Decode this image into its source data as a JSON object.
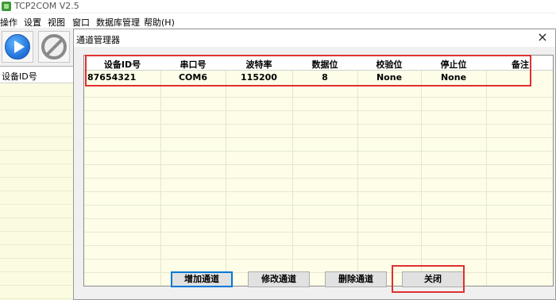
{
  "app": {
    "title": "TCP2COM V2.5"
  },
  "menu": {
    "items": [
      "操作",
      "设置",
      "视图",
      "窗口",
      "数据库管理",
      "帮助(H)"
    ]
  },
  "toolbar": {
    "start_icon": "play-icon",
    "stop_icon": "stop-icon"
  },
  "left_panel": {
    "header": "设备ID号"
  },
  "dialog": {
    "title": "通道管理器",
    "close_glyph": "×",
    "columns": [
      "设备ID号",
      "串口号",
      "波特率",
      "数据位",
      "校验位",
      "停止位",
      "备注"
    ],
    "rows": [
      [
        "87654321",
        "COM6",
        "115200",
        "8",
        "None",
        "None",
        ""
      ]
    ],
    "buttons": {
      "add": "增加通道",
      "edit": "修改通道",
      "delete": "删除通道",
      "close": "关闭"
    }
  },
  "colors": {
    "highlight": "#e03030",
    "grid_bg": "#fdfde8"
  }
}
